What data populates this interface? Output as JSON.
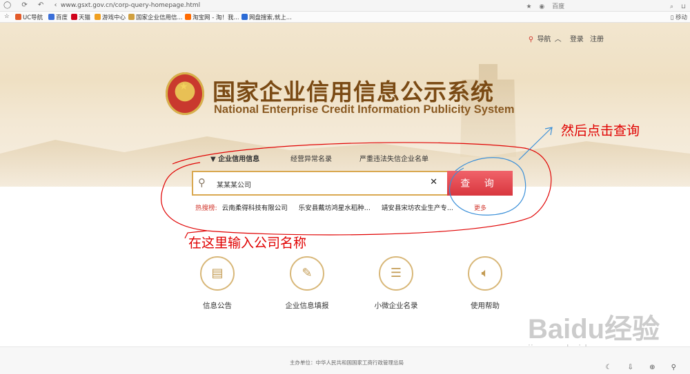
{
  "browser": {
    "url": "www.gsxt.gov.cn/corp-query-homepage.html",
    "search_engine": "百度",
    "mobile_label": "移动",
    "bookmarks": [
      "UC导航",
      "百度",
      "天猫",
      "游戏中心",
      "国家企业信用信...",
      "淘宝网 - 淘！我...",
      "网盘搜索,就上..."
    ]
  },
  "header": {
    "nav_label": "导航",
    "login": "登录",
    "register": "注册",
    "title_cn": "国家企业信用信息公示系统",
    "title_en": "National Enterprise Credit Information Publicity System"
  },
  "search": {
    "tabs": [
      "企业信用信息",
      "经营异常名录",
      "严重违法失信企业名单"
    ],
    "active_tab": "企业信用信息",
    "value": "某某某公司",
    "button_label": "查 询",
    "hot_label": "热搜榜:",
    "hot_items": [
      "云南柔得科技有限公司",
      "乐安县戴坊鸿星水稻种...",
      "靖安县宋坊农业生产专..."
    ],
    "more": "更多"
  },
  "annotations": {
    "click_query": "然后点击查询",
    "enter_company": "在这里输入公司名称"
  },
  "services": [
    {
      "label": "信息公告",
      "icon": "document-icon"
    },
    {
      "label": "企业信息填报",
      "icon": "pen-icon"
    },
    {
      "label": "小微企业名录",
      "icon": "list-icon"
    },
    {
      "label": "使用帮助",
      "icon": "speaker-icon"
    }
  ],
  "footer": {
    "text": "主办单位：中华人民共和国国家工商行政管理总局"
  },
  "watermark": {
    "brand": "Baidu经验",
    "url": "jingyan.baidu.com"
  },
  "colors": {
    "brand_brown": "#7a4a14",
    "query_red": "#e04a50",
    "annotation_red": "#e00000",
    "annotation_blue": "#3a8fd8"
  }
}
